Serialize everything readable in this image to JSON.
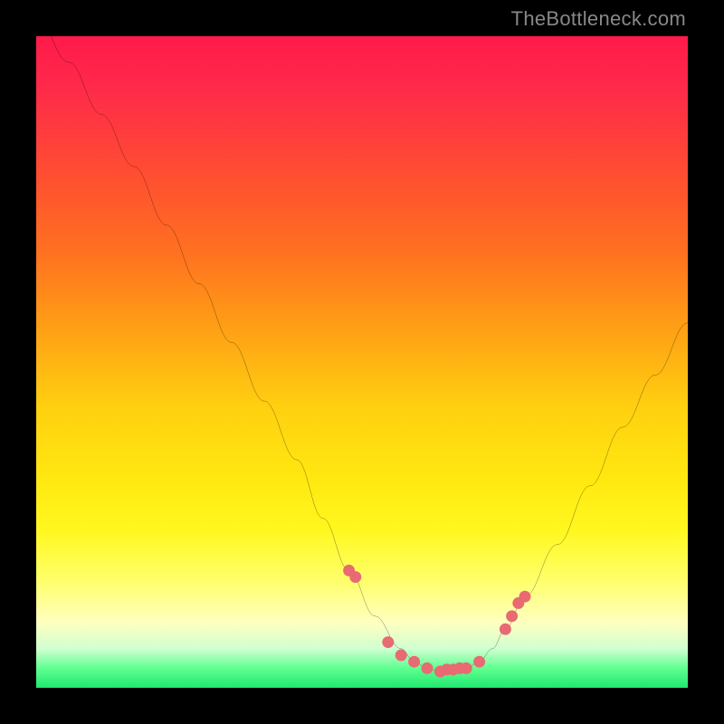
{
  "watermark": "TheBottleneck.com",
  "chart_data": {
    "type": "line",
    "title": "",
    "xlabel": "",
    "ylabel": "",
    "xlim": [
      0,
      100
    ],
    "ylim": [
      0,
      100
    ],
    "curve": {
      "x": [
        0,
        5,
        10,
        15,
        20,
        25,
        30,
        35,
        40,
        44,
        48,
        52,
        56,
        58,
        60,
        62,
        64,
        66,
        68,
        70,
        72,
        75,
        80,
        85,
        90,
        95,
        100
      ],
      "y": [
        103,
        96,
        88,
        80,
        71,
        62,
        53,
        44,
        35,
        26,
        18,
        11,
        6,
        4,
        3,
        2.5,
        2.5,
        3,
        4,
        6,
        9,
        14,
        22,
        31,
        40,
        48,
        56
      ]
    },
    "markers": {
      "x": [
        48,
        49,
        54,
        56,
        58,
        60,
        62,
        63,
        64,
        65,
        66,
        68,
        72,
        73,
        74,
        75
      ],
      "y": [
        18,
        17,
        7,
        5,
        4,
        3,
        2.5,
        2.8,
        2.8,
        3,
        3,
        4,
        9,
        11,
        13,
        14
      ],
      "color": "#e86a72",
      "size": 6
    }
  }
}
